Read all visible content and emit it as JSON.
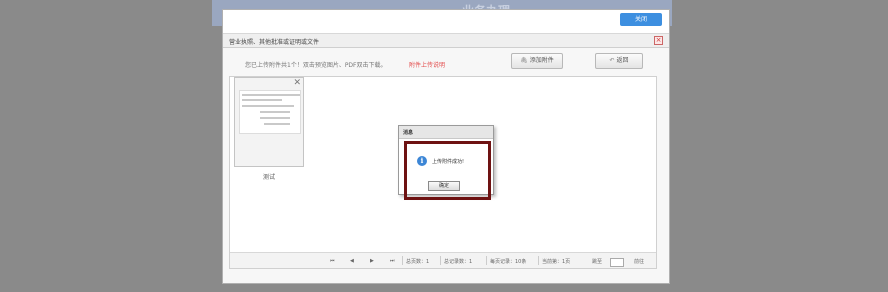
{
  "background": {
    "header_title": "业务办理",
    "close_label": "关闭"
  },
  "dialog": {
    "title": "营业执照、其他批准或证明或文件",
    "close_glyph": "×",
    "hint": "您已上传附件共1个！双击预览图片、PDF双击下载。",
    "hint_red": "附件上传说明",
    "add_button": "添加附件",
    "back_button": "返回"
  },
  "attachments": [
    {
      "name": "测试",
      "remove_glyph": "✕"
    }
  ],
  "pager": {
    "first": "⏮",
    "prev": "◀",
    "next": "▶",
    "last": "⏭",
    "total_pages": "总页数：1",
    "total_records": "总记录数：1",
    "per_page": "每页记录：10条",
    "current_page": "当前第：1页",
    "jump_label": "跳至",
    "go_label": "前往"
  },
  "message": {
    "title": "消息",
    "text": "上传附件成功!",
    "ok_label": "确定",
    "icon": "info-icon"
  },
  "colors": {
    "accent_blue": "#3d8fe0",
    "highlight_border": "#6e1212",
    "hint_red": "#e34b4b"
  }
}
